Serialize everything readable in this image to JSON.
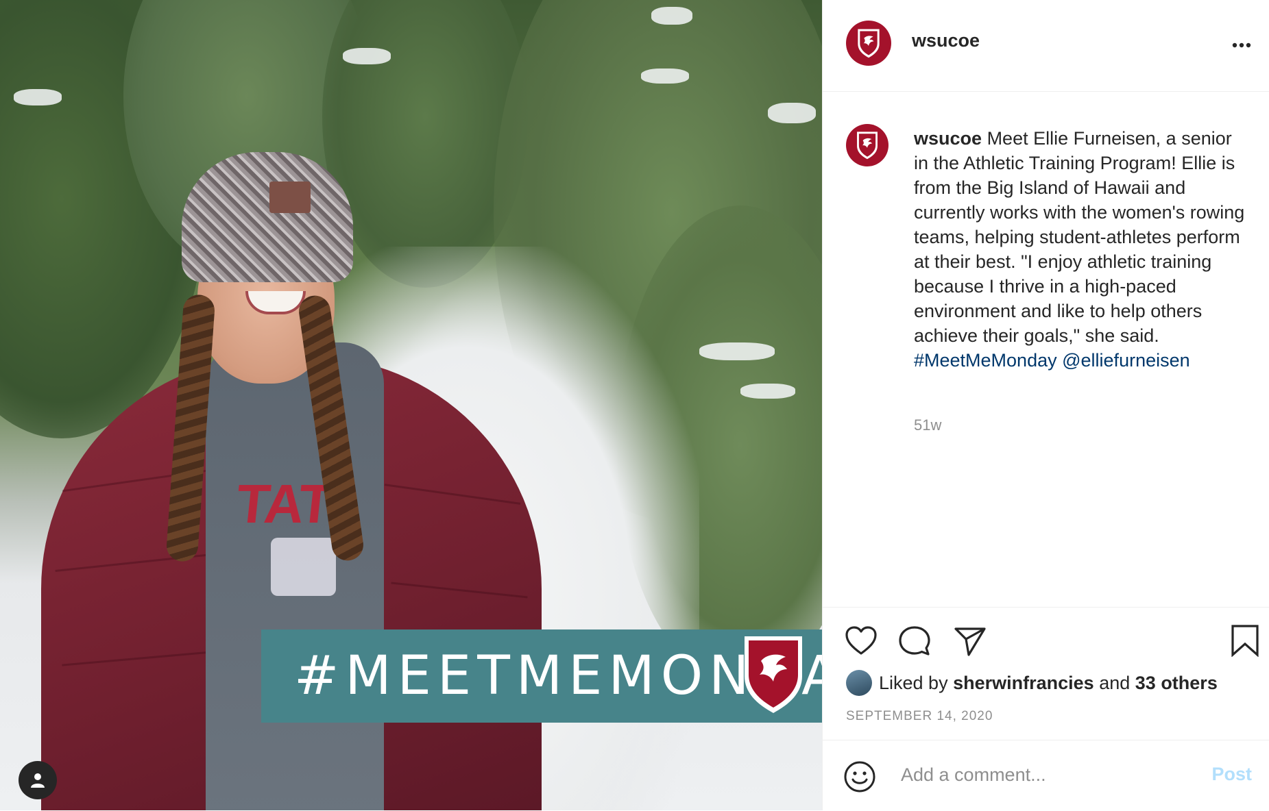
{
  "post": {
    "username": "wsucoe",
    "more_icon": "more-horizontal-icon",
    "image": {
      "banner_text": "#MEETMEMONDAY",
      "shirt_text": "TAT",
      "user_tag_icon": "person-icon"
    },
    "caption": {
      "username": "wsucoe",
      "text": "Meet Ellie Furneisen, a senior in the Athletic Training Program! Ellie is from the Big Island of Hawaii and currently works with the women's rowing teams, helping student-athletes perform at their best. \"I enjoy athletic training because I thrive in a high-paced environment and like to help others achieve their goals,\" she said.",
      "hashtag": "#MeetMeMonday",
      "mention": "@elliefurneisen",
      "time_ago": "51w"
    },
    "actions": {
      "like_icon": "heart-icon",
      "comment_icon": "comment-icon",
      "share_icon": "paper-plane-icon",
      "save_icon": "bookmark-icon"
    },
    "likes": {
      "prefix": "Liked by",
      "user": "sherwinfrancies",
      "conjunction": "and",
      "others": "33 others"
    },
    "date": "SEPTEMBER 14, 2020",
    "comment": {
      "placeholder": "Add a comment...",
      "emoji_icon": "smiley-icon",
      "post_label": "Post"
    }
  },
  "colors": {
    "brand": "#a4122b",
    "banner": "#47848a",
    "link": "#00376b",
    "post_disabled": "#b2dffc",
    "muted": "#8e8e8e"
  }
}
